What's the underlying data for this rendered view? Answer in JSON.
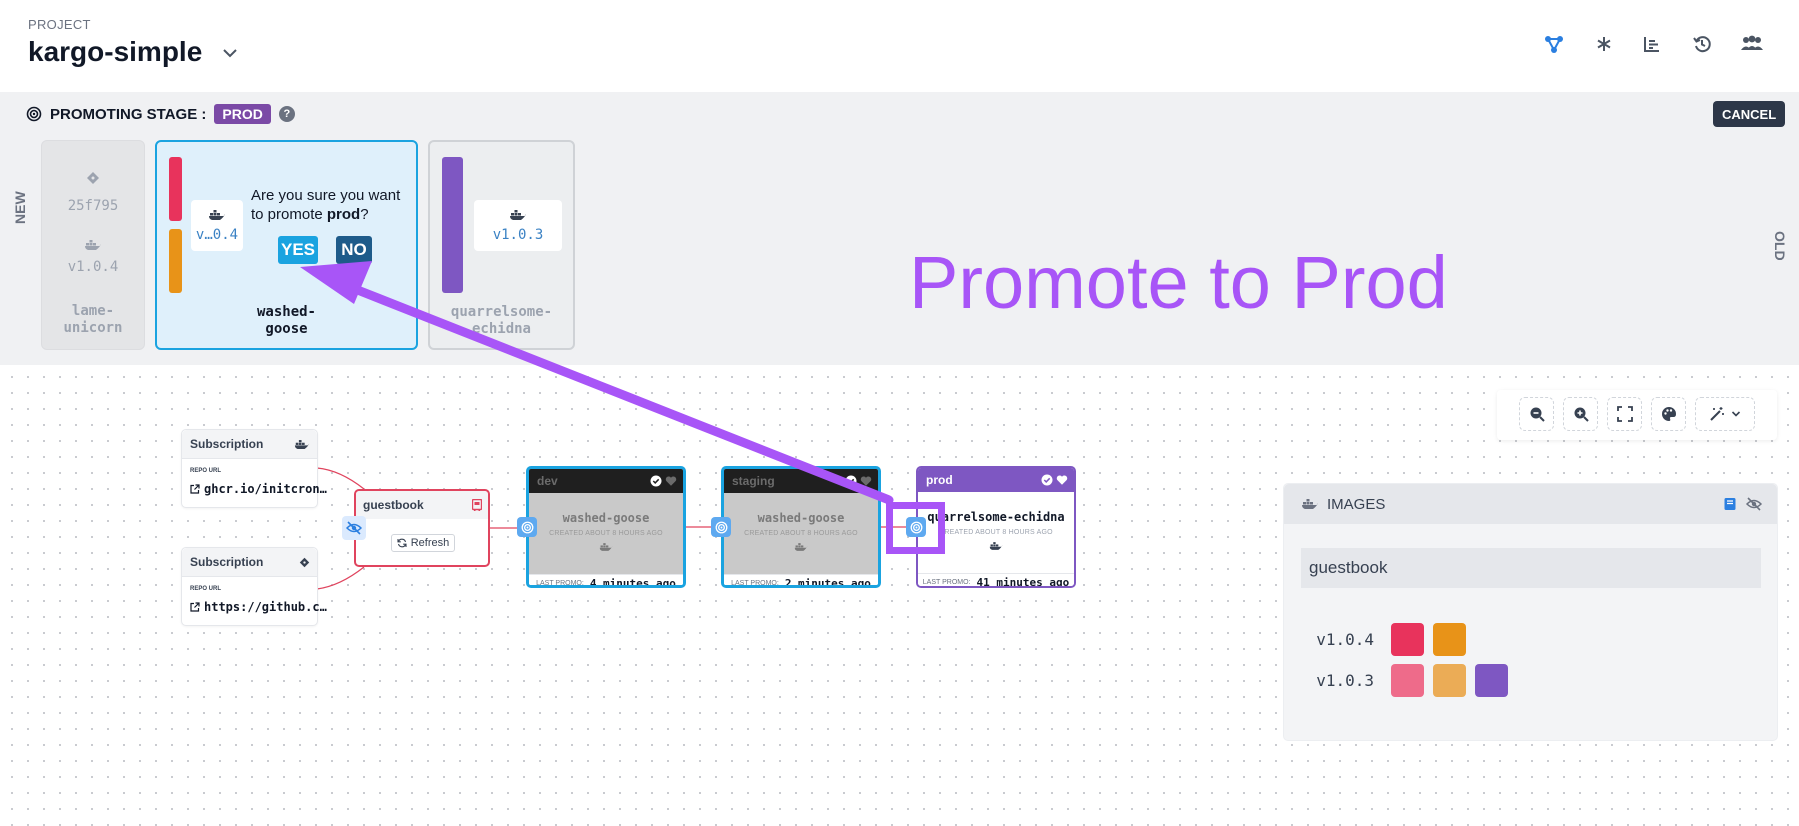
{
  "header": {
    "project_label": "PROJECT",
    "project_title": "kargo-simple",
    "icons": [
      "graph-icon",
      "asterisk-icon",
      "list-icon",
      "history-icon",
      "users-icon"
    ],
    "active_icon_color": "#2b7fe0"
  },
  "promotion": {
    "title": "PROMOTING STAGE :",
    "stage": "PROD",
    "help": "?",
    "cancel_label": "CANCEL",
    "new_label": "NEW",
    "old_label": "OLD",
    "freight": [
      {
        "commit": "25f795",
        "image_tag": "v1.0.4",
        "name_1": "lame-",
        "name_2": "unicorn"
      },
      {
        "image_tag": "v…0.4",
        "name_1": "washed-",
        "name_2": "goose",
        "bar_colors": [
          "#e8335c",
          "#e89318"
        ]
      },
      {
        "image_tag": "v1.0.3",
        "name_1": "quarrelsome-",
        "name_2": "echidna",
        "bar_colors": [
          "#7e57c2"
        ]
      }
    ],
    "confirm": {
      "line1": "Are you sure you want",
      "line2_prefix": "to promote ",
      "line2_stage": "prod",
      "line2_suffix": "?",
      "yes_label": "YES",
      "no_label": "NO"
    }
  },
  "annotation": {
    "text": "Promote to Prod",
    "color": "#a855f7"
  },
  "graph": {
    "subscriptions": [
      {
        "title": "Subscription",
        "repo_label": "REPO URL",
        "url": "ghcr.io/initcron…",
        "icon": "docker-icon"
      },
      {
        "title": "Subscription",
        "repo_label": "REPO URL",
        "url": "https://github.c…",
        "icon": "git-icon"
      }
    ],
    "warehouse": {
      "name": "guestbook",
      "refresh_label": "Refresh"
    },
    "stages": [
      {
        "name": "dev",
        "freight": "washed-goose",
        "created": "CREATED ABOUT 8 HOURS AGO",
        "last_promo_label": "LAST PROMO:",
        "last_promo": "4 minutes ago"
      },
      {
        "name": "staging",
        "freight": "washed-goose",
        "created": "CREATED ABOUT 8 HOURS AGO",
        "last_promo_label": "LAST PROMO:",
        "last_promo": "2 minutes ago"
      },
      {
        "name": "prod",
        "freight": "quarrelsome-echidna",
        "created": "CREATED ABOUT 8 HOURS AGO",
        "last_promo_label": "LAST PROMO:",
        "last_promo": "41 minutes ago"
      }
    ],
    "edge_color": "#e0445e"
  },
  "images": {
    "title": "IMAGES",
    "repo": "guestbook",
    "tags": [
      {
        "tag": "v1.0.4",
        "colors": [
          "#e8335c",
          "#e89318"
        ]
      },
      {
        "tag": "v1.0.3",
        "colors": [
          "#ee6b8a",
          "#ebac56",
          "#7e57c2"
        ]
      }
    ]
  }
}
